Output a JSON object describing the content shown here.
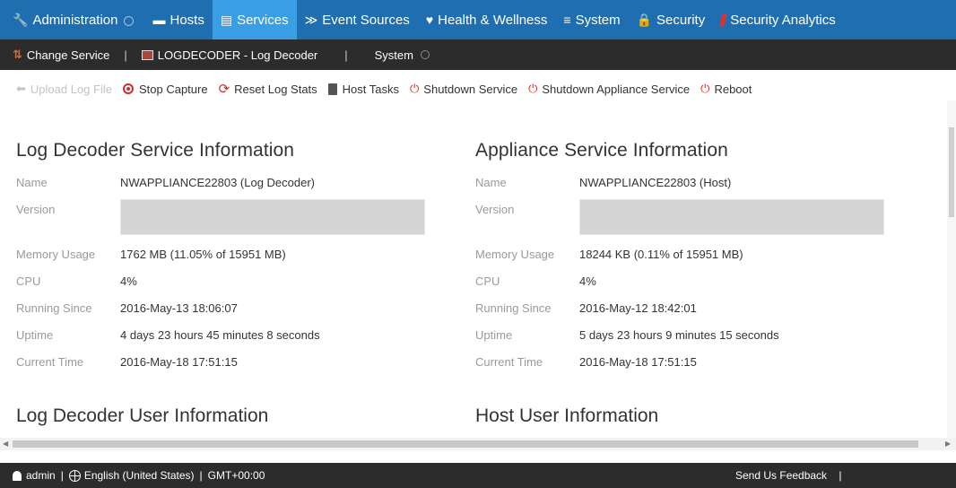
{
  "topnav": {
    "admin": "Administration",
    "items": [
      {
        "label": "Hosts",
        "icon": "hosts-icon"
      },
      {
        "label": "Services",
        "icon": "services-icon"
      },
      {
        "label": "Event Sources",
        "icon": "rss-icon"
      },
      {
        "label": "Health & Wellness",
        "icon": "heart-icon"
      },
      {
        "label": "System",
        "icon": "system-icon"
      },
      {
        "label": "Security",
        "icon": "lock-icon"
      },
      {
        "label": "Security Analytics",
        "icon": "security-analytics-icon"
      }
    ],
    "active_color": "#3a9ee5",
    "bar_color": "#1f6fb0"
  },
  "subbar": {
    "change_service": "Change Service",
    "service": "LOGDECODER - Log Decoder",
    "view": "System"
  },
  "toolbar": {
    "upload": "Upload Log File",
    "stop_capture": "Stop Capture",
    "reset_stats": "Reset Log Stats",
    "host_tasks": "Host Tasks",
    "shutdown_service": "Shutdown Service",
    "shutdown_appliance": "Shutdown Appliance Service",
    "reboot": "Reboot"
  },
  "log_decoder": {
    "title": "Log Decoder Service Information",
    "labels": {
      "name": "Name",
      "version": "Version",
      "memory": "Memory Usage",
      "cpu": "CPU",
      "running": "Running Since",
      "uptime": "Uptime",
      "current": "Current Time"
    },
    "name": "NWAPPLIANCE22803 (Log Decoder)",
    "memory": "1762 MB (11.05% of 15951 MB)",
    "cpu": "4%",
    "running": "2016-May-13 18:06:07",
    "uptime": "4 days 23 hours 45 minutes 8 seconds",
    "current": "2016-May-18 17:51:15",
    "user_title": "Log Decoder User Information"
  },
  "appliance": {
    "title": "Appliance Service Information",
    "labels": {
      "name": "Name",
      "version": "Version",
      "memory": "Memory Usage",
      "cpu": "CPU",
      "running": "Running Since",
      "uptime": "Uptime",
      "current": "Current Time"
    },
    "name": "NWAPPLIANCE22803 (Host)",
    "memory": "18244 KB (0.11% of 15951 MB)",
    "cpu": "4%",
    "running": "2016-May-12 18:42:01",
    "uptime": "5 days 23 hours 9 minutes 15 seconds",
    "current": "2016-May-18 17:51:15",
    "user_title": "Host User Information"
  },
  "footer": {
    "user": "admin",
    "locale": "English (United States)",
    "timezone": "GMT+00:00",
    "feedback": "Send Us Feedback"
  }
}
